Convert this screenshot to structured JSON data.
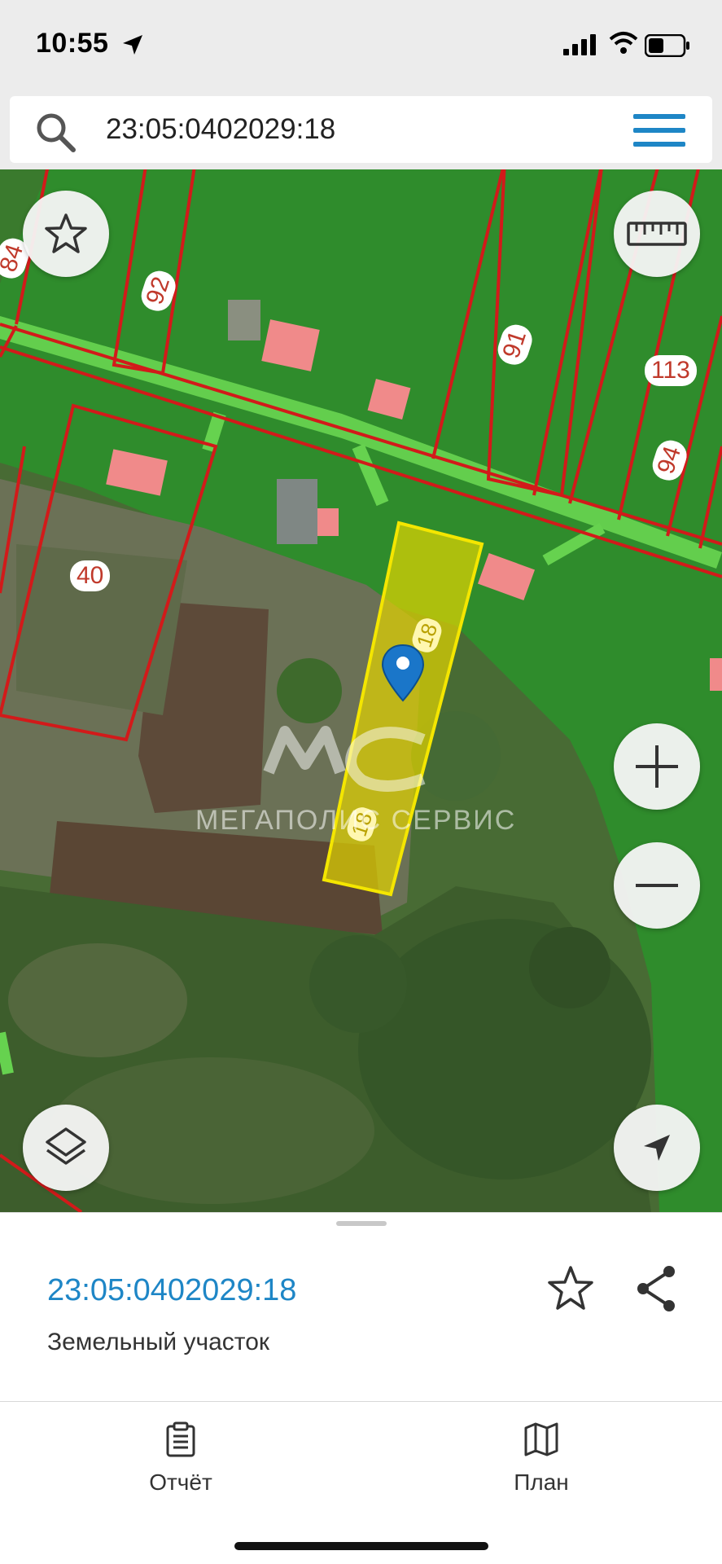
{
  "status_bar": {
    "time": "10:55",
    "icons": [
      "location-arrow-icon",
      "cellular-signal-icon",
      "wifi-icon",
      "battery-icon"
    ]
  },
  "search": {
    "value": "23:05:0402029:18",
    "icon": "search-icon",
    "menu_icon": "hamburger-menu-icon"
  },
  "map": {
    "parcel_labels": [
      "92",
      "91",
      "113",
      "94",
      "40",
      "84"
    ],
    "selected_parcel_labels": [
      "18",
      "18"
    ],
    "watermark": "МЕГАПОЛИС СЕРВИС",
    "watermark_logo": "МС",
    "buttons": {
      "favorite": "star-icon",
      "ruler": "ruler-icon",
      "zoom_in": "plus-icon",
      "zoom_out": "minus-icon",
      "layers": "layers-icon",
      "locate": "navigation-arrow-icon"
    },
    "colors": {
      "parcel_border": "#d21a1a",
      "selected_fill": "#e8d800",
      "road": "#5ed24a",
      "building": "#f08080"
    }
  },
  "sheet": {
    "parcel_id": "23:05:0402029:18",
    "parcel_type": "Земельный участок",
    "favorite_icon": "star-outline-icon",
    "share_icon": "share-icon"
  },
  "tabbar": {
    "tabs": [
      {
        "label": "Отчёт",
        "icon": "clipboard-icon"
      },
      {
        "label": "План",
        "icon": "map-icon"
      }
    ]
  },
  "colors": {
    "accent": "#1e86c6",
    "menu": "#1e86c6"
  }
}
